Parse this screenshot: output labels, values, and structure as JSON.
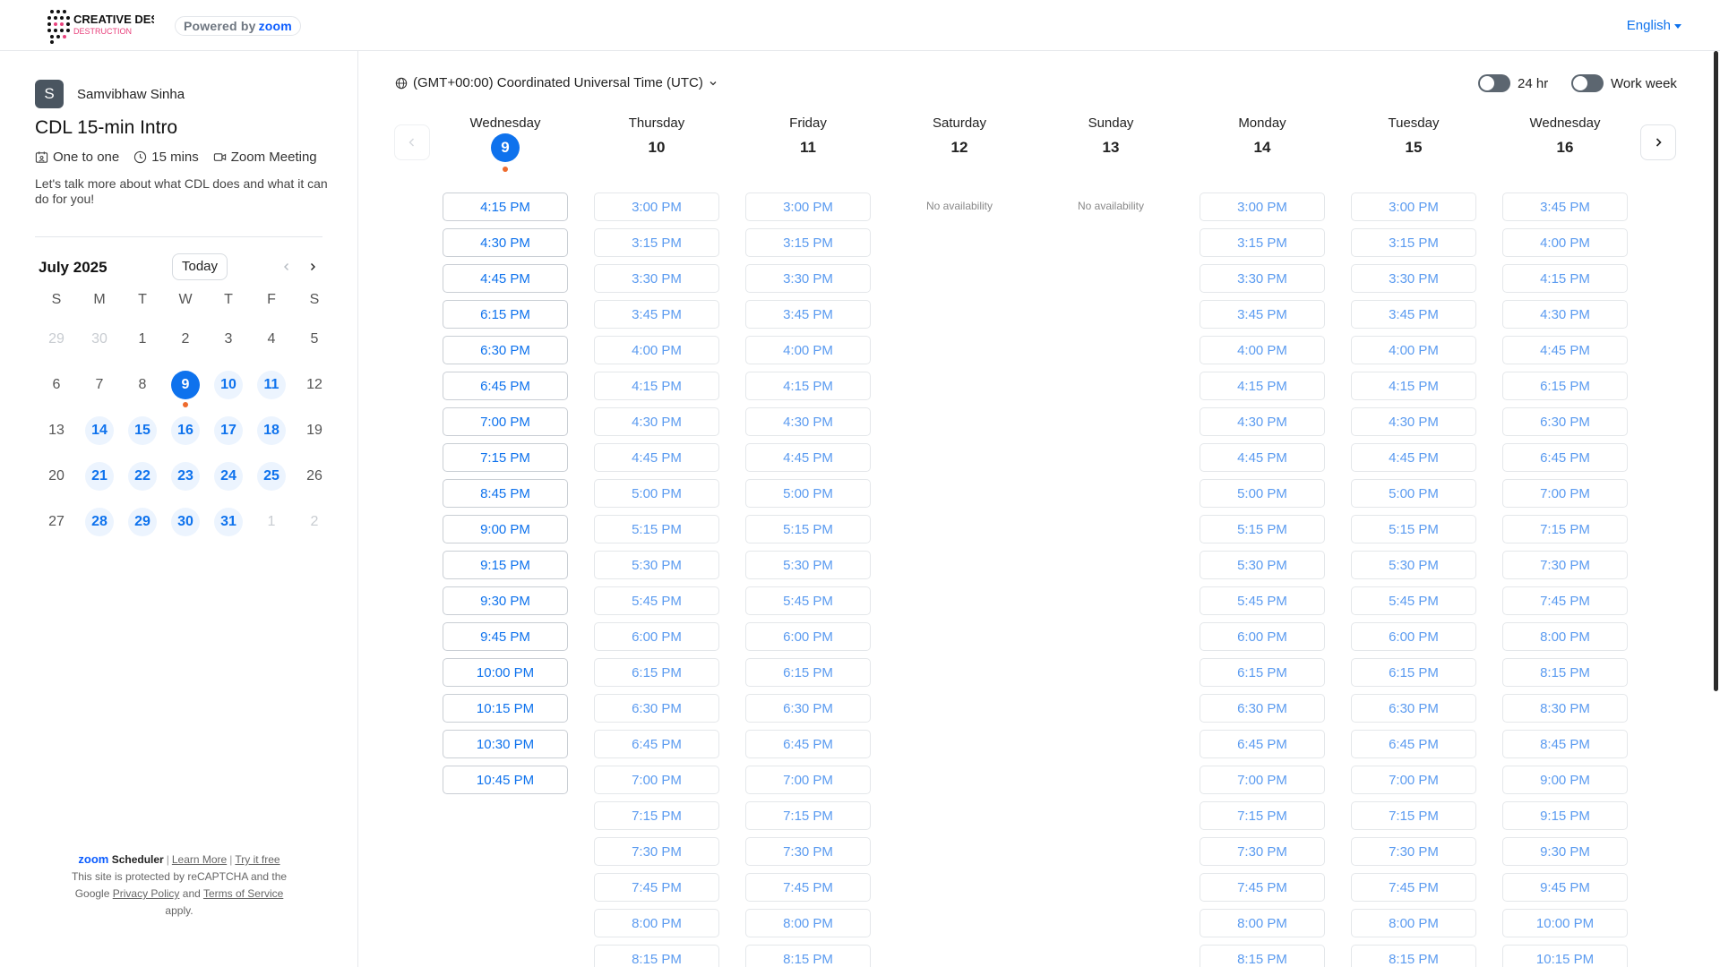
{
  "header": {
    "logo_text": "CREATIVE DESTRUCTION LAB",
    "powered_label": "Powered by",
    "powered_brand": "zoom",
    "language": "English"
  },
  "host": {
    "avatar_initial": "S",
    "name": "Samvibhaw Sinha"
  },
  "event": {
    "title": "CDL 15-min Intro",
    "type": "One to one",
    "duration": "15 mins",
    "location": "Zoom Meeting",
    "description": "Let's talk more about what CDL does and what it can do for you!"
  },
  "calendar": {
    "month_label": "July 2025",
    "today_label": "Today",
    "dow": [
      "S",
      "M",
      "T",
      "W",
      "T",
      "F",
      "S"
    ],
    "weeks": [
      [
        {
          "d": "29",
          "s": "out"
        },
        {
          "d": "30",
          "s": "out"
        },
        {
          "d": "1",
          "s": "plain"
        },
        {
          "d": "2",
          "s": "plain"
        },
        {
          "d": "3",
          "s": "plain"
        },
        {
          "d": "4",
          "s": "plain"
        },
        {
          "d": "5",
          "s": "plain"
        }
      ],
      [
        {
          "d": "6",
          "s": "plain"
        },
        {
          "d": "7",
          "s": "plain"
        },
        {
          "d": "8",
          "s": "plain"
        },
        {
          "d": "9",
          "s": "sel",
          "today": true
        },
        {
          "d": "10",
          "s": "avail"
        },
        {
          "d": "11",
          "s": "avail"
        },
        {
          "d": "12",
          "s": "plain"
        }
      ],
      [
        {
          "d": "13",
          "s": "plain"
        },
        {
          "d": "14",
          "s": "avail"
        },
        {
          "d": "15",
          "s": "avail"
        },
        {
          "d": "16",
          "s": "avail"
        },
        {
          "d": "17",
          "s": "avail"
        },
        {
          "d": "18",
          "s": "avail"
        },
        {
          "d": "19",
          "s": "plain"
        }
      ],
      [
        {
          "d": "20",
          "s": "plain"
        },
        {
          "d": "21",
          "s": "avail"
        },
        {
          "d": "22",
          "s": "avail"
        },
        {
          "d": "23",
          "s": "avail"
        },
        {
          "d": "24",
          "s": "avail"
        },
        {
          "d": "25",
          "s": "avail"
        },
        {
          "d": "26",
          "s": "plain"
        }
      ],
      [
        {
          "d": "27",
          "s": "plain"
        },
        {
          "d": "28",
          "s": "avail"
        },
        {
          "d": "29",
          "s": "avail"
        },
        {
          "d": "30",
          "s": "avail"
        },
        {
          "d": "31",
          "s": "avail"
        },
        {
          "d": "1",
          "s": "out"
        },
        {
          "d": "2",
          "s": "out"
        }
      ]
    ]
  },
  "footer": {
    "brand": "zoom",
    "product": "Scheduler",
    "learn_more": "Learn More",
    "try_free": "Try it free",
    "recaptcha_1": "This site is protected by reCAPTCHA and the",
    "recaptcha_2a": "Google",
    "privacy": "Privacy Policy",
    "and": "and",
    "terms": "Terms of Service",
    "apply": "apply."
  },
  "main": {
    "timezone": "(GMT+00:00) Coordinated Universal Time (UTC)",
    "toggle_24hr": "24 hr",
    "toggle_workweek": "Work week",
    "no_availability": "No availability",
    "columns": [
      {
        "name": "Wednesday",
        "num": "9",
        "selected": true,
        "style": "strong",
        "slots": [
          "4:15 PM",
          "4:30 PM",
          "4:45 PM",
          "6:15 PM",
          "6:30 PM",
          "6:45 PM",
          "7:00 PM",
          "7:15 PM",
          "8:45 PM",
          "9:00 PM",
          "9:15 PM",
          "9:30 PM",
          "9:45 PM",
          "10:00 PM",
          "10:15 PM",
          "10:30 PM",
          "10:45 PM"
        ]
      },
      {
        "name": "Thursday",
        "num": "10",
        "style": "light",
        "slots": [
          "3:00 PM",
          "3:15 PM",
          "3:30 PM",
          "3:45 PM",
          "4:00 PM",
          "4:15 PM",
          "4:30 PM",
          "4:45 PM",
          "5:00 PM",
          "5:15 PM",
          "5:30 PM",
          "5:45 PM",
          "6:00 PM",
          "6:15 PM",
          "6:30 PM",
          "6:45 PM",
          "7:00 PM",
          "7:15 PM",
          "7:30 PM",
          "7:45 PM",
          "8:00 PM",
          "8:15 PM"
        ]
      },
      {
        "name": "Friday",
        "num": "11",
        "style": "light",
        "slots": [
          "3:00 PM",
          "3:15 PM",
          "3:30 PM",
          "3:45 PM",
          "4:00 PM",
          "4:15 PM",
          "4:30 PM",
          "4:45 PM",
          "5:00 PM",
          "5:15 PM",
          "5:30 PM",
          "5:45 PM",
          "6:00 PM",
          "6:15 PM",
          "6:30 PM",
          "6:45 PM",
          "7:00 PM",
          "7:15 PM",
          "7:30 PM",
          "7:45 PM",
          "8:00 PM",
          "8:15 PM"
        ]
      },
      {
        "name": "Saturday",
        "num": "12",
        "style": "light",
        "slots": []
      },
      {
        "name": "Sunday",
        "num": "13",
        "style": "light",
        "slots": []
      },
      {
        "name": "Monday",
        "num": "14",
        "style": "light",
        "slots": [
          "3:00 PM",
          "3:15 PM",
          "3:30 PM",
          "3:45 PM",
          "4:00 PM",
          "4:15 PM",
          "4:30 PM",
          "4:45 PM",
          "5:00 PM",
          "5:15 PM",
          "5:30 PM",
          "5:45 PM",
          "6:00 PM",
          "6:15 PM",
          "6:30 PM",
          "6:45 PM",
          "7:00 PM",
          "7:15 PM",
          "7:30 PM",
          "7:45 PM",
          "8:00 PM",
          "8:15 PM"
        ]
      },
      {
        "name": "Tuesday",
        "num": "15",
        "style": "light",
        "slots": [
          "3:00 PM",
          "3:15 PM",
          "3:30 PM",
          "3:45 PM",
          "4:00 PM",
          "4:15 PM",
          "4:30 PM",
          "4:45 PM",
          "5:00 PM",
          "5:15 PM",
          "5:30 PM",
          "5:45 PM",
          "6:00 PM",
          "6:15 PM",
          "6:30 PM",
          "6:45 PM",
          "7:00 PM",
          "7:15 PM",
          "7:30 PM",
          "7:45 PM",
          "8:00 PM",
          "8:15 PM"
        ]
      },
      {
        "name": "Wednesday",
        "num": "16",
        "style": "light",
        "slots": [
          "3:45 PM",
          "4:00 PM",
          "4:15 PM",
          "4:30 PM",
          "4:45 PM",
          "6:15 PM",
          "6:30 PM",
          "6:45 PM",
          "7:00 PM",
          "7:15 PM",
          "7:30 PM",
          "7:45 PM",
          "8:00 PM",
          "8:15 PM",
          "8:30 PM",
          "8:45 PM",
          "9:00 PM",
          "9:15 PM",
          "9:30 PM",
          "9:45 PM",
          "10:00 PM",
          "10:15 PM"
        ]
      }
    ]
  },
  "colors": {
    "accent": "#0e72ed",
    "today_dot": "#ee6b2d",
    "zoom_brand": "#0b5cff"
  }
}
